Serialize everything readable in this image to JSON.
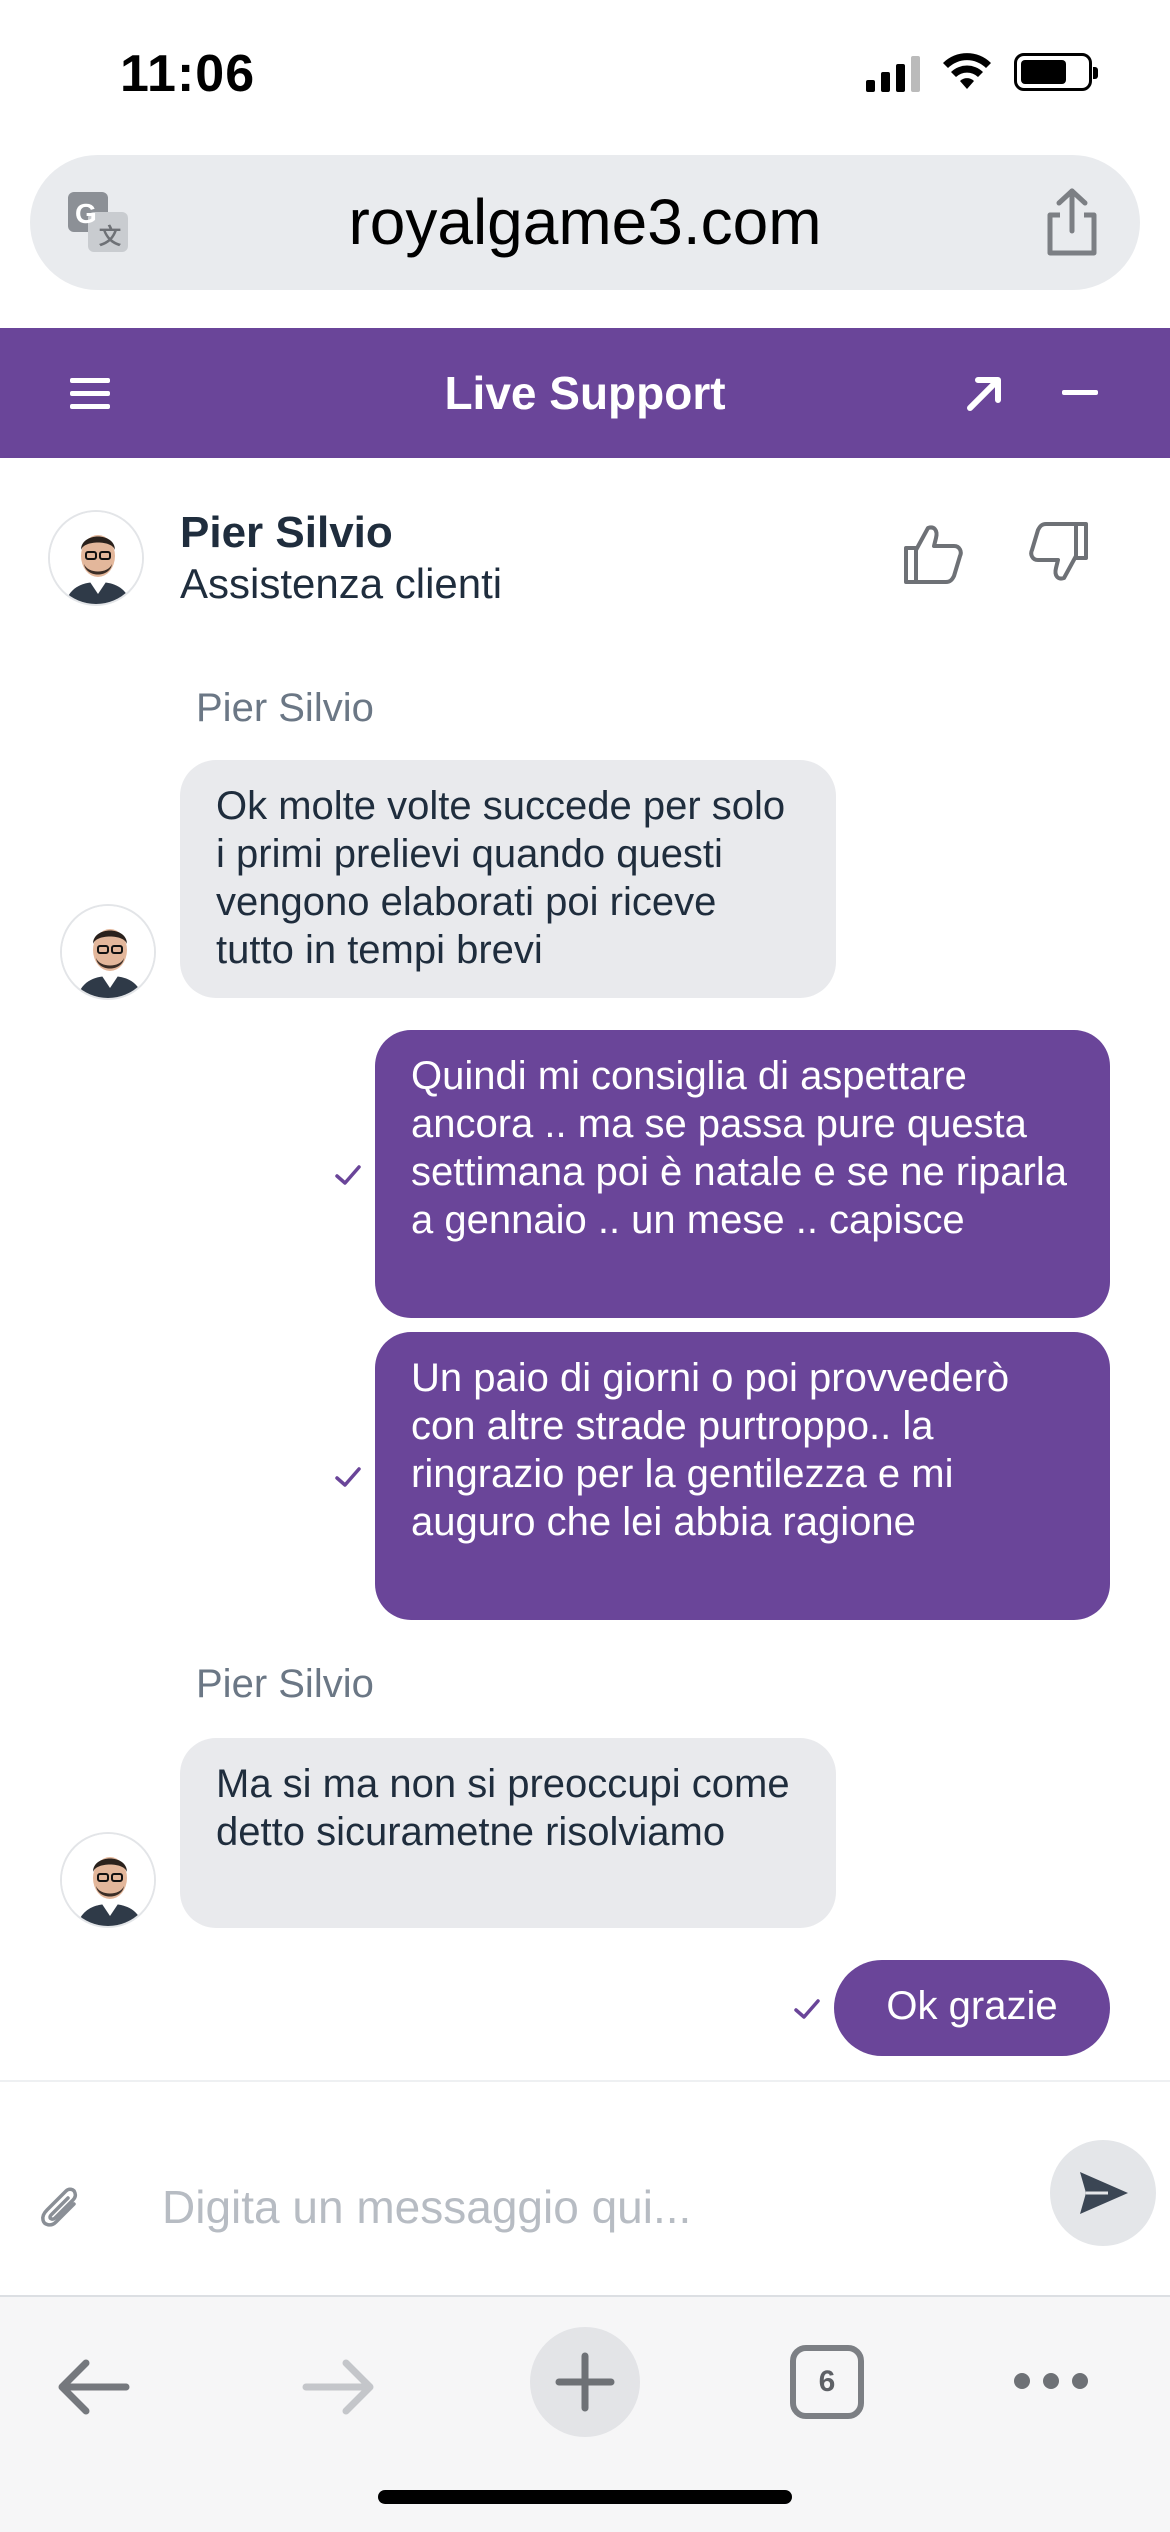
{
  "status": {
    "time": "11:06"
  },
  "browser": {
    "url": "royalgame3.com",
    "tab_count": "6"
  },
  "chat_header": {
    "title": "Live Support"
  },
  "agent": {
    "name": "Pier Silvio",
    "role": "Assistenza clienti"
  },
  "messages": [
    {
      "from": "agent",
      "sender": "Pier Silvio",
      "text": "Ok molte volte succede per solo i primi prelievi quando questi vengono elaborati poi riceve tutto in tempi brevi"
    },
    {
      "from": "user",
      "text": "Quindi mi consiglia di aspettare ancora .. ma se passa pure questa settimana poi è natale e se ne riparla a gennaio .. un mese .. capisce"
    },
    {
      "from": "user",
      "text": "Un paio di giorni o poi provvederò con altre strade purtroppo.. la ringrazio per la gentilezza e mi auguro che lei abbia ragione"
    },
    {
      "from": "agent",
      "sender": "Pier Silvio",
      "text": "Ma si ma non si preoccupi come detto sicurametne risolviamo"
    },
    {
      "from": "user",
      "text": "Ok grazie"
    }
  ],
  "composer": {
    "placeholder": "Digita un messaggio qui..."
  },
  "colors": {
    "brand": "#6a4599",
    "incoming_bubble": "#e9eaed",
    "placeholder": "#b7bcc3"
  },
  "icons": [
    "translate-icon",
    "share-icon",
    "menu-icon",
    "expand-icon",
    "minimize-icon",
    "thumbs-up-icon",
    "thumbs-down-icon",
    "check-icon",
    "paperclip-icon",
    "send-icon",
    "back-arrow-icon",
    "forward-arrow-icon",
    "plus-icon",
    "tabs-icon",
    "more-icon"
  ]
}
